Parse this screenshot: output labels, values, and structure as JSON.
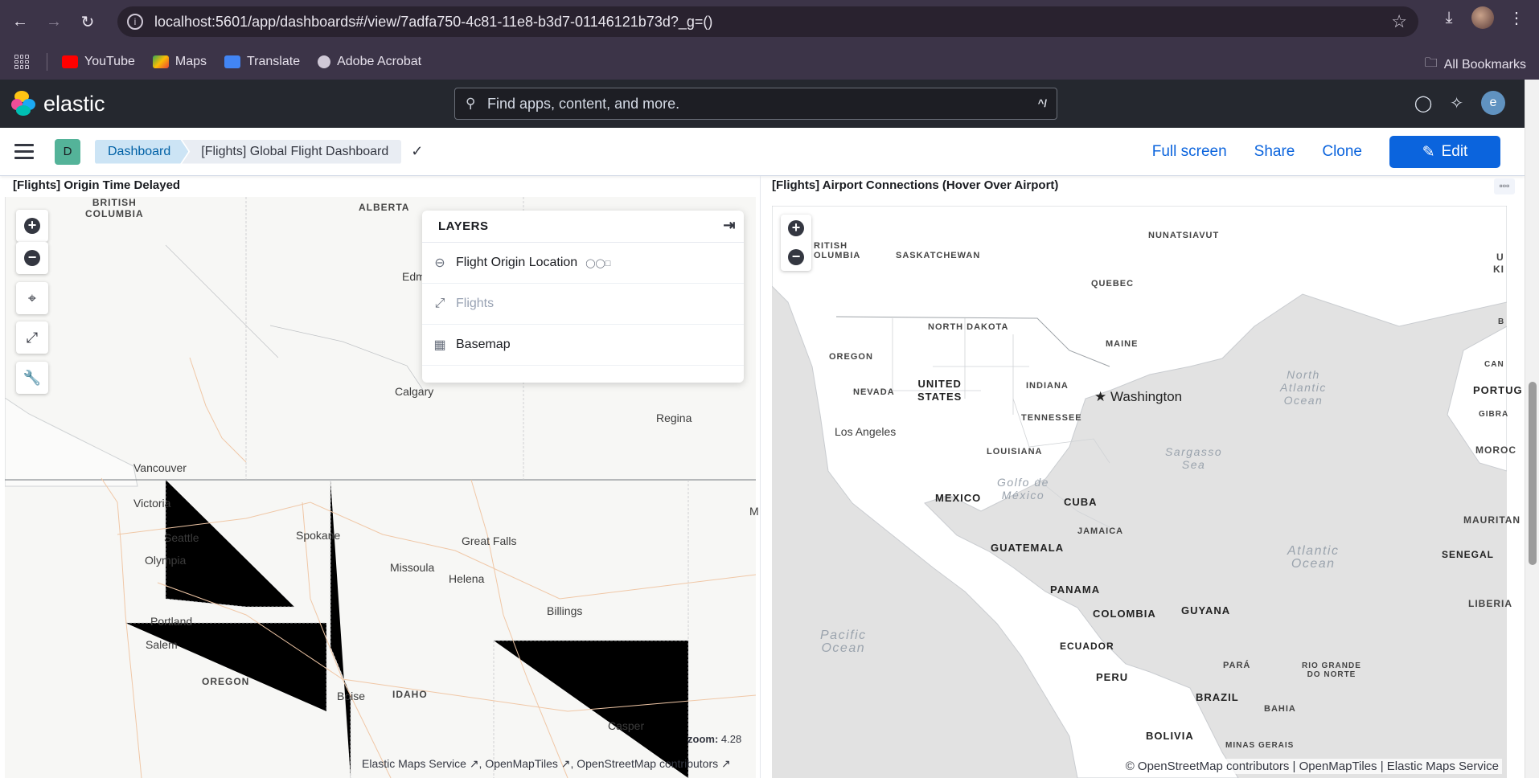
{
  "browser": {
    "url": "localhost:5601/app/dashboards#/view/7adfa750-4c81-11e8-b3d7-01146121b73d?_g=()",
    "bookmarks": [
      {
        "label": "YouTube",
        "color": "#ff0000"
      },
      {
        "label": "Maps",
        "color": "#34a853"
      },
      {
        "label": "Translate",
        "color": "#4285f4"
      },
      {
        "label": "Adobe Acrobat",
        "color": "#cfc8d6"
      }
    ],
    "all_bookmarks": "All Bookmarks"
  },
  "kibana": {
    "brand": "elastic",
    "search_placeholder": "Find apps, content, and more.",
    "search_shortcut": "^/",
    "user_initial": "e"
  },
  "subnav": {
    "space_initial": "D",
    "breadcrumb_root": "Dashboard",
    "breadcrumb_current": "[Flights] Global Flight Dashboard",
    "actions": {
      "fullscreen": "Full screen",
      "share": "Share",
      "clone": "Clone",
      "edit": "Edit"
    }
  },
  "panel_left": {
    "title": "[Flights] Origin Time Delayed",
    "layers_title": "LAYERS",
    "layers": [
      {
        "label": "Flight Origin Location",
        "icon": "circle-minus-icon"
      },
      {
        "label": "Flights",
        "icon": "line-icon"
      },
      {
        "label": "Basemap",
        "icon": "grid-icon"
      }
    ],
    "zoom_label": "zoom:",
    "zoom_value": "4.28",
    "attribution": "Elastic Maps Service ↗, OpenMapTiles ↗, OpenStreetMap contributors ↗",
    "map_labels": {
      "bc": "BRITISH\nCOLUMBIA",
      "alberta": "ALBERTA",
      "edm": "Edm",
      "calgary": "Calgary",
      "regina": "Regina",
      "vancouver": "Vancouver",
      "victoria": "Victoria",
      "seattle": "Seattle",
      "olympia": "Olympia",
      "spokane": "Spokane",
      "greatfalls": "Great Falls",
      "missoula": "Missoula",
      "helena": "Helena",
      "billings": "Billings",
      "portland": "Portland",
      "salem": "Salem",
      "oregon": "OREGON",
      "boise": "Boise",
      "idaho": "IDAHO",
      "casper": "Casper",
      "m": "M"
    }
  },
  "panel_right": {
    "title": "[Flights] Airport Connections (Hover Over Airport)",
    "attribution": "© OpenStreetMap contributors | OpenMapTiles | Elastic Maps Service",
    "map_labels": {
      "bc": "RITISH\nOLUMBIA",
      "sask": "SASKATCHEWAN",
      "nunavut": "NUNATSIAVUT",
      "quebec": "QUEBEC",
      "nd": "NORTH DAKOTA",
      "maine": "MAINE",
      "oregon": "OREGON",
      "nevada": "NEVADA",
      "us": "UNITED\nSTATES",
      "indiana": "INDIANA",
      "washington": "Washington",
      "tennessee": "TENNESSEE",
      "la": "Los Angeles",
      "louisiana": "LOUISIANA",
      "golfo": "Golfo de\nMéxico",
      "northatl": "North\nAtlantic\nOcean",
      "sargasso": "Sargasso\nSea",
      "mexico": "MEXICO",
      "cuba": "CUBA",
      "jamaica": "JAMAICA",
      "guatemala": "GUATEMALA",
      "atlantic": "Atlantic\nOcean",
      "panama": "PANAMA",
      "colombia": "COLOMBIA",
      "guyana": "GUYANA",
      "pacific": "Pacific\nOcean",
      "ecuador": "ECUADOR",
      "peru": "PERU",
      "para": "PARÁ",
      "riogrande": "RIO GRANDE\nDO NORTE",
      "brazil": "BRAZIL",
      "bahia": "BAHIA",
      "bolivia": "BOLIVIA",
      "minas": "MINAS GERAIS",
      "portug": "PORTUG",
      "gibra": "GIBRA",
      "moroc": "MOROC",
      "mauritan": "MAURITAN",
      "senegal": "SENEGAL",
      "liberia": "LIBERIA",
      "can": "CAN",
      "u": "U",
      "ki": "KI",
      "b": "B"
    }
  }
}
